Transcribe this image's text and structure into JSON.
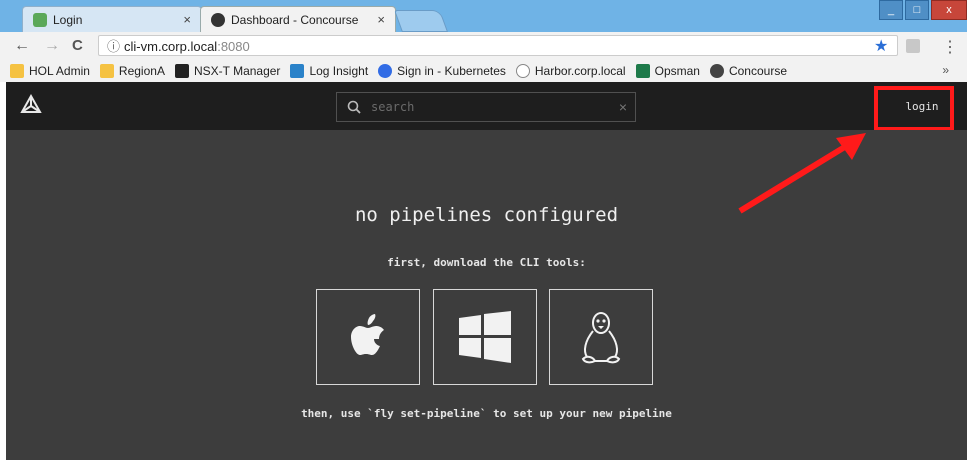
{
  "browser": {
    "tabs": [
      {
        "title": "Login",
        "close": "×"
      },
      {
        "title": "Dashboard - Concourse",
        "close": "×"
      }
    ],
    "window_buttons": [
      "_",
      "□",
      "x"
    ],
    "address": {
      "host": "cli-vm.corp.local",
      "port": ":8080",
      "info_icon": "ⓘ"
    },
    "nav": {
      "back": "←",
      "forward": "→",
      "reload": "C"
    },
    "bookmarks": [
      {
        "label": "HOL Admin",
        "icon": "folder-icon",
        "color": "#f5c242"
      },
      {
        "label": "RegionA",
        "icon": "folder-icon",
        "color": "#f5c242"
      },
      {
        "label": "NSX-T Manager",
        "icon": "nsx-icon",
        "color": "#222222"
      },
      {
        "label": "Log Insight",
        "icon": "loginsight-icon",
        "color": "#2a82c9"
      },
      {
        "label": "Sign in - Kubernetes",
        "icon": "kubernetes-icon",
        "color": "#326ce5"
      },
      {
        "label": "Harbor.corp.local",
        "icon": "harbor-icon",
        "color": "#888888"
      },
      {
        "label": "Opsman",
        "icon": "opsman-icon",
        "color": "#1e7a4a"
      },
      {
        "label": "Concourse",
        "icon": "concourse-icon",
        "color": "#444444"
      }
    ],
    "bookmarks_more": "»"
  },
  "app": {
    "search_placeholder": "search",
    "search_clear": "×",
    "login_label": "login",
    "headline": "no pipelines configured",
    "download_text": "first, download the CLI tools:",
    "cli_tools": [
      {
        "name": "apple-icon",
        "platform": "macOS"
      },
      {
        "name": "windows-icon",
        "platform": "Windows"
      },
      {
        "name": "linux-icon",
        "platform": "Linux"
      }
    ],
    "footer_text": "then, use `fly set-pipeline` to set up your new pipeline"
  },
  "annotation": {
    "color": "#ff1a1a"
  }
}
